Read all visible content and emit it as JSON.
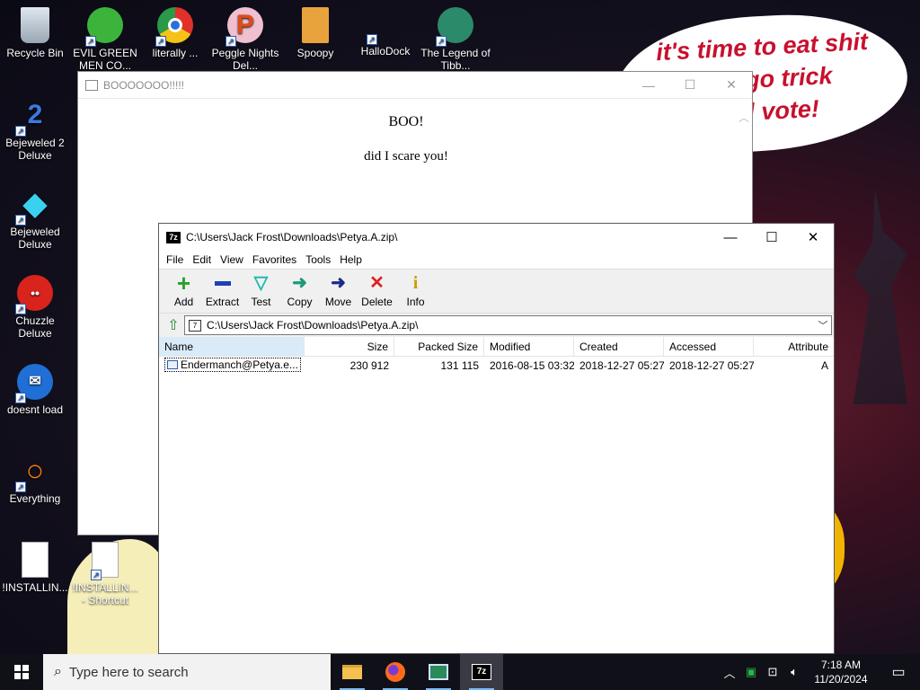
{
  "desktop": {
    "speech_bubble": "it's time to eat shit\nand go trick\nand vote!",
    "icons": [
      {
        "label": "Recycle Bin"
      },
      {
        "label": "EVIL GREEN MEN CO..."
      },
      {
        "label": "literally ..."
      },
      {
        "label": "Peggle Nights Del..."
      },
      {
        "label": "Spoopy"
      },
      {
        "label": "HalloDock"
      },
      {
        "label": "The Legend of Tibb..."
      },
      {
        "label": "Bejeweled 2 Deluxe"
      },
      {
        "label": "Bejeweled Deluxe"
      },
      {
        "label": "Chuzzle Deluxe"
      },
      {
        "label": "doesnt load"
      },
      {
        "label": "Everything"
      },
      {
        "label": "!INSTALLIN..."
      },
      {
        "label": "!INSTALLIN... - Shortcut"
      }
    ]
  },
  "boo_window": {
    "title": "BOOOOOOO!!!!!",
    "heading": "BOO!",
    "subtext": "did I scare you!"
  },
  "zip_window": {
    "title": "C:\\Users\\Jack Frost\\Downloads\\Petya.A.zip\\",
    "menu": [
      "File",
      "Edit",
      "View",
      "Favorites",
      "Tools",
      "Help"
    ],
    "toolbar": [
      {
        "label": "Add",
        "icon": "plus-icon"
      },
      {
        "label": "Extract",
        "icon": "minus-icon"
      },
      {
        "label": "Test",
        "icon": "check-icon"
      },
      {
        "label": "Copy",
        "icon": "copy-arrow-icon"
      },
      {
        "label": "Move",
        "icon": "move-arrow-icon"
      },
      {
        "label": "Delete",
        "icon": "delete-x-icon"
      },
      {
        "label": "Info",
        "icon": "info-icon"
      }
    ],
    "address": "C:\\Users\\Jack Frost\\Downloads\\Petya.A.zip\\",
    "columns": [
      "Name",
      "Size",
      "Packed Size",
      "Modified",
      "Created",
      "Accessed",
      "Attribute"
    ],
    "rows": [
      {
        "name": "Endermanch@Petya.e...",
        "size": "230 912",
        "packed": "131 115",
        "modified": "2016-08-15 03:32",
        "created": "2018-12-27 05:27",
        "accessed": "2018-12-27 05:27",
        "attr": "A"
      }
    ]
  },
  "taskbar": {
    "search_placeholder": "Type here to search",
    "time": "7:18 AM",
    "date": "11/20/2024"
  },
  "colors": {
    "accent_blue": "#2a5db0",
    "speech_red": "#c8102e",
    "taskbar": "#101018"
  }
}
